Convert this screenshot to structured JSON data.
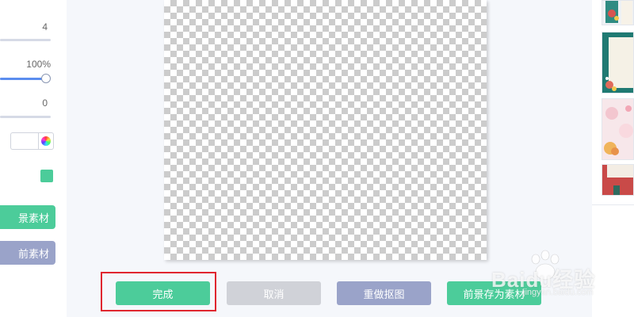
{
  "left_panel": {
    "value_1": "4",
    "opacity_value": "100%",
    "value_3": "0",
    "background_button_label": "景素材",
    "foreground_button_label": "前素材"
  },
  "actions": {
    "done_label": "完成",
    "cancel_label": "取消",
    "redo_label": "重做抠图",
    "save_label": "前景存为素材"
  },
  "watermark": {
    "brand": "Baidu经验",
    "url": "jingyan.baidu.com"
  },
  "colors": {
    "primary_green": "#4ccc9a",
    "disabled_gray": "#d0d2d8",
    "slate_blue": "#9aa3c9",
    "highlight_red": "#e0262f",
    "canvas_check": "#cccccc"
  },
  "icons": [
    "color-wheel-icon",
    "paw-logo-icon"
  ]
}
